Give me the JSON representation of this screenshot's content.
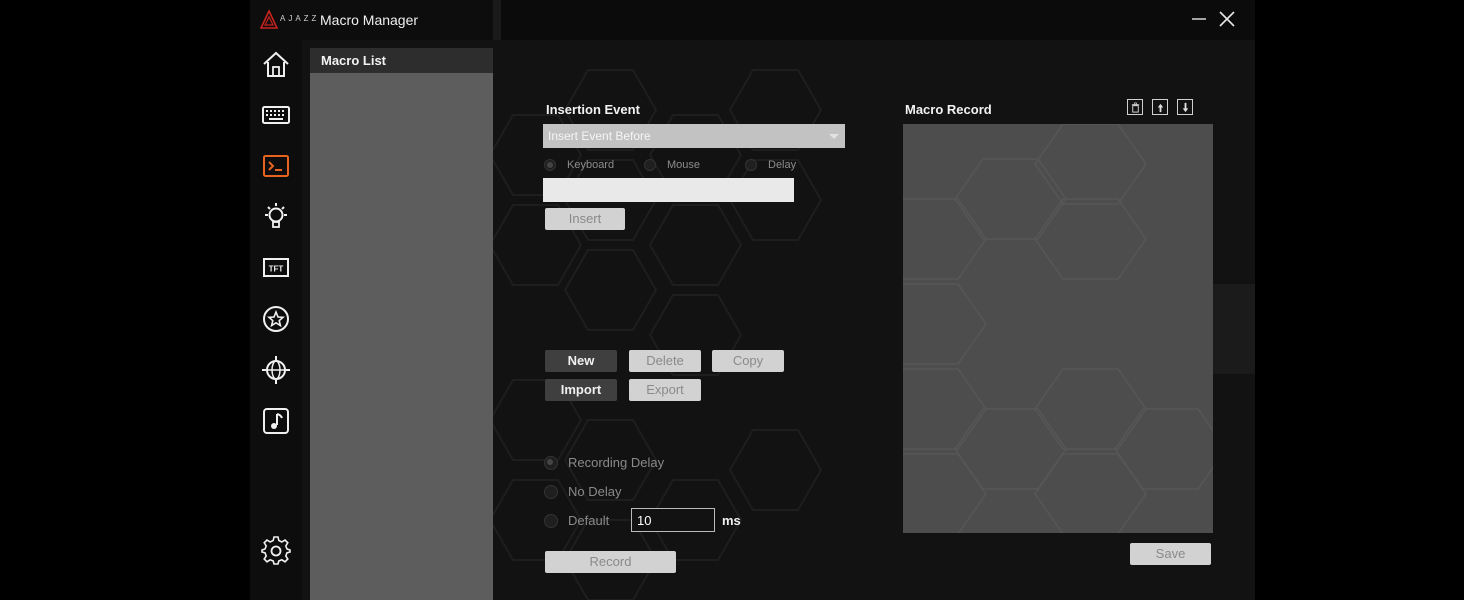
{
  "window": {
    "brand": "AJAZZ",
    "title": "Macro Manager"
  },
  "nav": {
    "items": [
      {
        "icon": "home-icon"
      },
      {
        "icon": "keyboard-icon"
      },
      {
        "icon": "terminal-icon",
        "active": true
      },
      {
        "icon": "lightbulb-icon"
      },
      {
        "icon": "tft-icon",
        "label": "TFT"
      },
      {
        "icon": "star-icon"
      },
      {
        "icon": "globe-icon"
      },
      {
        "icon": "music-icon"
      },
      {
        "icon": "gear-icon"
      }
    ]
  },
  "macro_list": {
    "title": "Macro List"
  },
  "insertion": {
    "title": "Insertion Event",
    "select_value": "Insert Event Before",
    "types": [
      "Keyboard",
      "Mouse",
      "Delay"
    ],
    "selected_type": "Keyboard",
    "input_value": "",
    "insert_label": "Insert"
  },
  "actions": {
    "new_label": "New",
    "delete_label": "Delete",
    "copy_label": "Copy",
    "import_label": "Import",
    "export_label": "Export"
  },
  "recording": {
    "options": [
      "Recording Delay",
      "No Delay",
      "Default"
    ],
    "selected": "Recording Delay",
    "default_delay": "10",
    "unit": "ms",
    "record_label": "Record"
  },
  "macro_record": {
    "title": "Macro Record",
    "save_label": "Save"
  },
  "colors": {
    "accent": "#e8641e",
    "logo_red": "#c8231e",
    "panel_gray": "#5d5d5d",
    "record_gray": "#4d4d4d"
  }
}
